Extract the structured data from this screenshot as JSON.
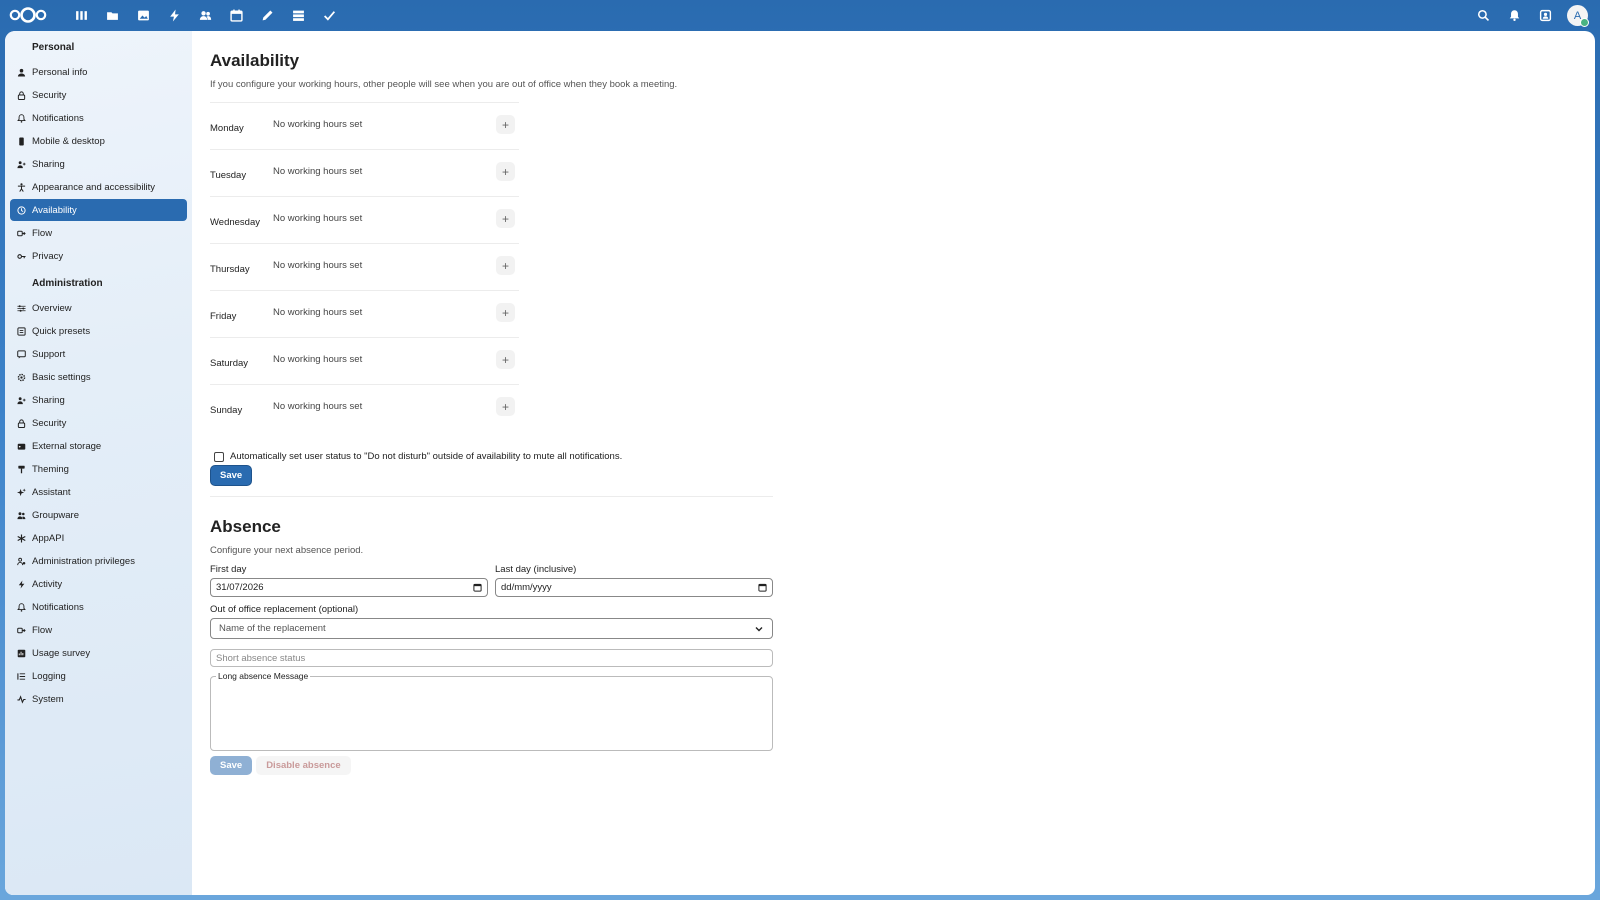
{
  "topbar": {
    "apps": [
      "dashboard-icon",
      "files-icon",
      "photos-icon",
      "activity-icon",
      "contacts-icon",
      "calendar-icon",
      "notes-icon",
      "deck-icon",
      "tasks-icon"
    ],
    "avatar_initial": "A"
  },
  "sidebar": {
    "personal_title": "Personal",
    "personal_items": [
      {
        "label": "Personal info",
        "icon": "user-icon"
      },
      {
        "label": "Security",
        "icon": "lock-icon"
      },
      {
        "label": "Notifications",
        "icon": "bell-icon"
      },
      {
        "label": "Mobile & desktop",
        "icon": "phone-icon"
      },
      {
        "label": "Sharing",
        "icon": "share-icon"
      },
      {
        "label": "Appearance and accessibility",
        "icon": "accessibility-icon"
      },
      {
        "label": "Availability",
        "icon": "clock-icon"
      },
      {
        "label": "Flow",
        "icon": "flow-icon"
      },
      {
        "label": "Privacy",
        "icon": "key-icon"
      }
    ],
    "admin_title": "Administration",
    "admin_items": [
      {
        "label": "Overview",
        "icon": "sliders-icon"
      },
      {
        "label": "Quick presets",
        "icon": "presets-icon"
      },
      {
        "label": "Support",
        "icon": "chat-icon"
      },
      {
        "label": "Basic settings",
        "icon": "gear-icon"
      },
      {
        "label": "Sharing",
        "icon": "share-icon"
      },
      {
        "label": "Security",
        "icon": "lock-icon"
      },
      {
        "label": "External storage",
        "icon": "storage-icon"
      },
      {
        "label": "Theming",
        "icon": "brush-icon"
      },
      {
        "label": "Assistant",
        "icon": "sparkle-icon"
      },
      {
        "label": "Groupware",
        "icon": "group-icon"
      },
      {
        "label": "AppAPI",
        "icon": "api-icon"
      },
      {
        "label": "Administration privileges",
        "icon": "admin-icon"
      },
      {
        "label": "Activity",
        "icon": "bolt-icon"
      },
      {
        "label": "Notifications",
        "icon": "bell-icon"
      },
      {
        "label": "Flow",
        "icon": "flow-icon"
      },
      {
        "label": "Usage survey",
        "icon": "chart-icon"
      },
      {
        "label": "Logging",
        "icon": "list-icon"
      },
      {
        "label": "System",
        "icon": "pulse-icon"
      }
    ]
  },
  "availability": {
    "title": "Availability",
    "description": "If you configure your working hours, other people will see when you are out of office when they book a meeting.",
    "days": [
      {
        "name": "Monday",
        "hours": "No working hours set"
      },
      {
        "name": "Tuesday",
        "hours": "No working hours set"
      },
      {
        "name": "Wednesday",
        "hours": "No working hours set"
      },
      {
        "name": "Thursday",
        "hours": "No working hours set"
      },
      {
        "name": "Friday",
        "hours": "No working hours set"
      },
      {
        "name": "Saturday",
        "hours": "No working hours set"
      },
      {
        "name": "Sunday",
        "hours": "No working hours set"
      }
    ],
    "dnd_label": "Automatically set user status to \"Do not disturb\" outside of availability to mute all notifications.",
    "save_label": "Save"
  },
  "absence": {
    "title": "Absence",
    "description": "Configure your next absence period.",
    "first_day_label": "First day",
    "first_day_value": "31/07/2026",
    "last_day_label": "Last day (inclusive)",
    "last_day_value": "dd/mm/yyyy",
    "replacement_label": "Out of office replacement (optional)",
    "replacement_placeholder": "Name of the replacement",
    "short_status_placeholder": "Short absence status",
    "long_message_label": "Long absence Message",
    "save_label": "Save",
    "disable_label": "Disable absence"
  }
}
